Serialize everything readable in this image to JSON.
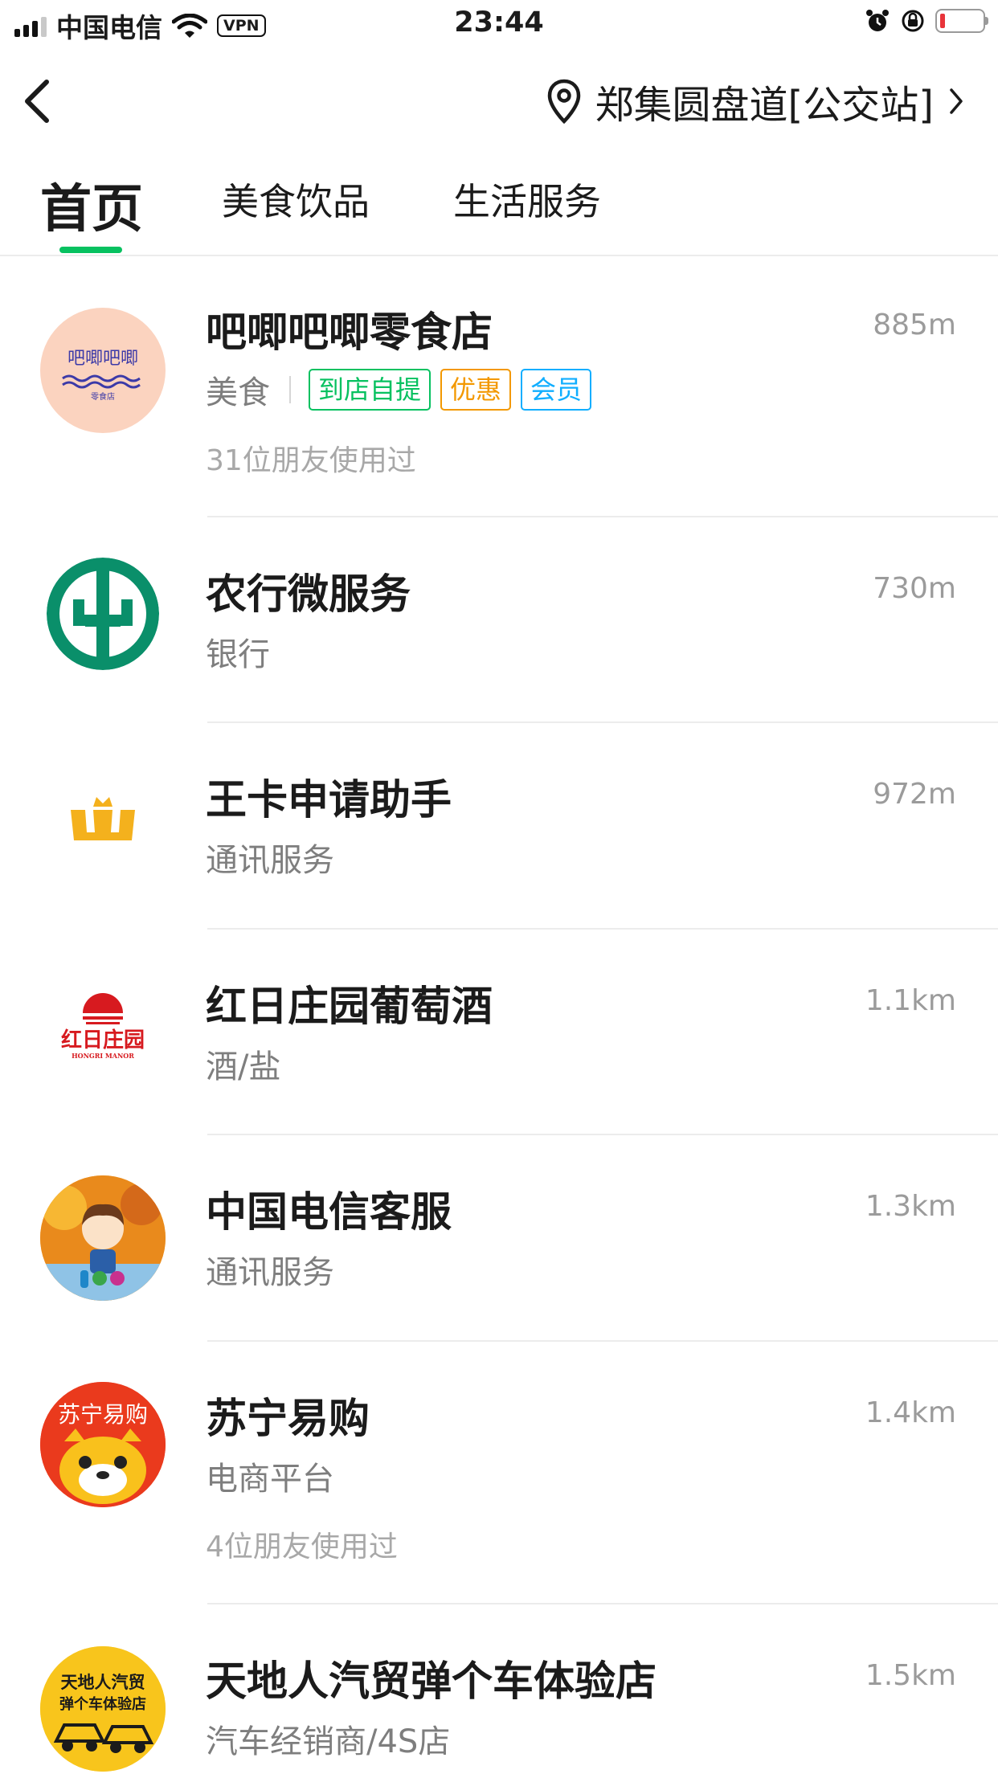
{
  "status_bar": {
    "carrier": "中国电信",
    "vpn": "VPN",
    "time": "23:44"
  },
  "nav": {
    "location": "郑集圆盘道[公交站]"
  },
  "tabs": [
    {
      "label": "首页",
      "active": true
    },
    {
      "label": "美食饮品",
      "active": false
    },
    {
      "label": "生活服务",
      "active": false
    }
  ],
  "colors": {
    "accent": "#07c160",
    "tag_green": "#07c160",
    "tag_orange": "#f39800",
    "tag_blue": "#10aeff"
  },
  "items": [
    {
      "name": "吧唧吧唧零食店",
      "distance": "885m",
      "category": "美食",
      "tags": [
        "到店自提",
        "优惠",
        "会员"
      ],
      "friends": "31位朋友使用过",
      "logo_icon": "snack-shop-logo",
      "logo_text": "吧唧吧唧",
      "logo_small": "零食店"
    },
    {
      "name": "农行微服务",
      "distance": "730m",
      "category": "银行",
      "logo_icon": "abc-bank-logo"
    },
    {
      "name": "王卡申请助手",
      "distance": "972m",
      "category": "通讯服务",
      "logo_icon": "wangka-logo"
    },
    {
      "name": "红日庄园葡萄酒",
      "distance": "1.1km",
      "category": "酒/盐",
      "logo_icon": "hongri-manor-logo",
      "logo_text": "红日庄园",
      "logo_small": "HONGRI MANOR"
    },
    {
      "name": "中国电信客服",
      "distance": "1.3km",
      "category": "通讯服务",
      "logo_icon": "telecom-mascot-logo"
    },
    {
      "name": "苏宁易购",
      "distance": "1.4km",
      "category": "电商平台",
      "friends": "4位朋友使用过",
      "logo_icon": "suning-logo",
      "logo_text": "苏宁易购"
    },
    {
      "name": "天地人汽贸弹个车体验店",
      "distance": "1.5km",
      "category": "汽车经销商/4S店",
      "logo_icon": "car-dealer-logo",
      "logo_text": "天地人汽贸",
      "logo_small": "弹个车体验店"
    }
  ]
}
